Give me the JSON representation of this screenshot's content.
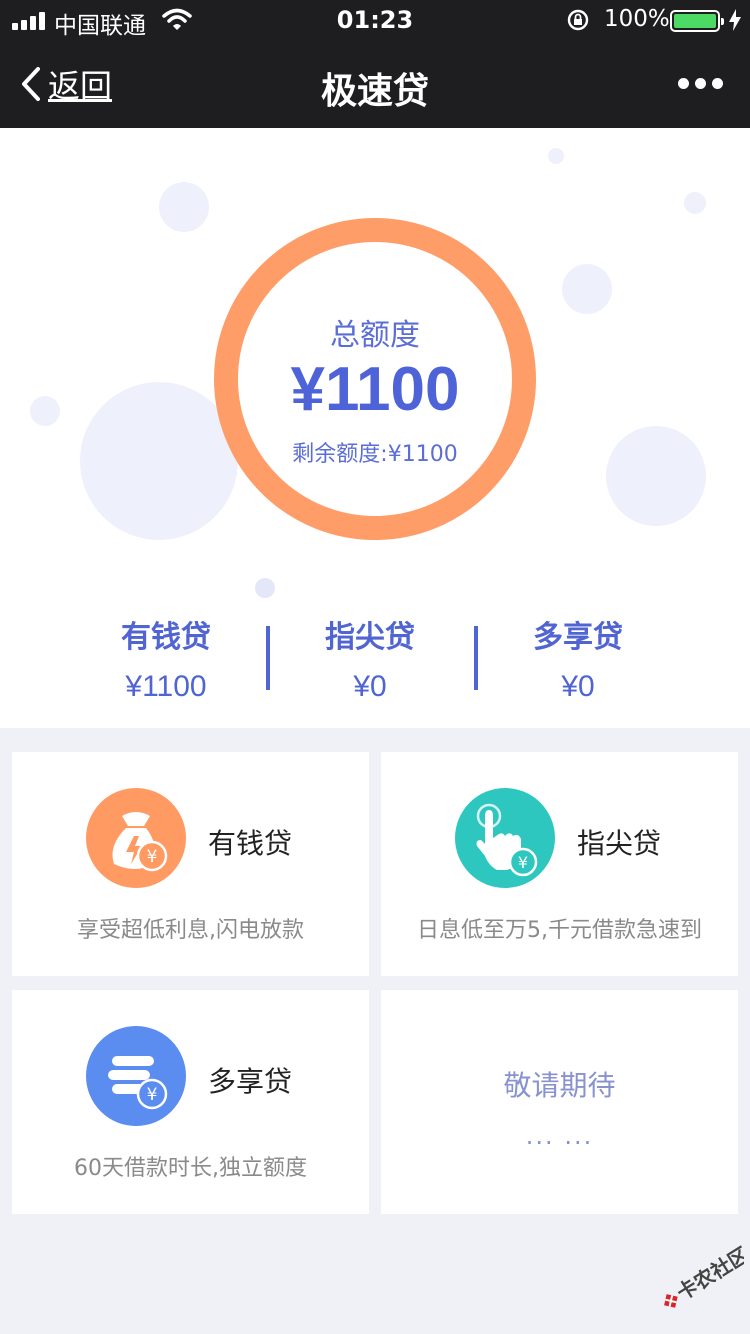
{
  "status_bar": {
    "carrier": "中国联通",
    "time": "01:23",
    "battery_percent": "100%",
    "battery_level": 1.0,
    "battery_color": "#4cd964"
  },
  "nav": {
    "back_label": "返回",
    "title": "极速贷"
  },
  "credit": {
    "label": "总额度",
    "amount": "¥1100",
    "remaining": "剩余额度:¥1100",
    "ring_color": "#ff9d69"
  },
  "summary": [
    {
      "name": "有钱贷",
      "value": "¥1100"
    },
    {
      "name": "指尖贷",
      "value": "¥0"
    },
    {
      "name": "多享贷",
      "value": "¥0"
    }
  ],
  "products": [
    {
      "title": "有钱贷",
      "desc": "享受超低利息,闪电放款",
      "icon": "money-bag-icon",
      "color": "#ff9a63"
    },
    {
      "title": "指尖贷",
      "desc": "日息低至万5,千元借款急速到",
      "icon": "finger-tap-icon",
      "color": "#2ec7c0"
    },
    {
      "title": "多享贷",
      "desc": "60天借款时长,独立额度",
      "icon": "coin-stack-icon",
      "color": "#5b8cf0"
    }
  ],
  "coming_soon": {
    "title": "敬请期待",
    "dots": "... ..."
  },
  "watermark": {
    "text": "卡农社区",
    "icon": "knot-logo-icon"
  },
  "colors": {
    "accent": "#5064d2",
    "header_bg": "#1e1e20",
    "page_bg": "#f0f1f6"
  }
}
